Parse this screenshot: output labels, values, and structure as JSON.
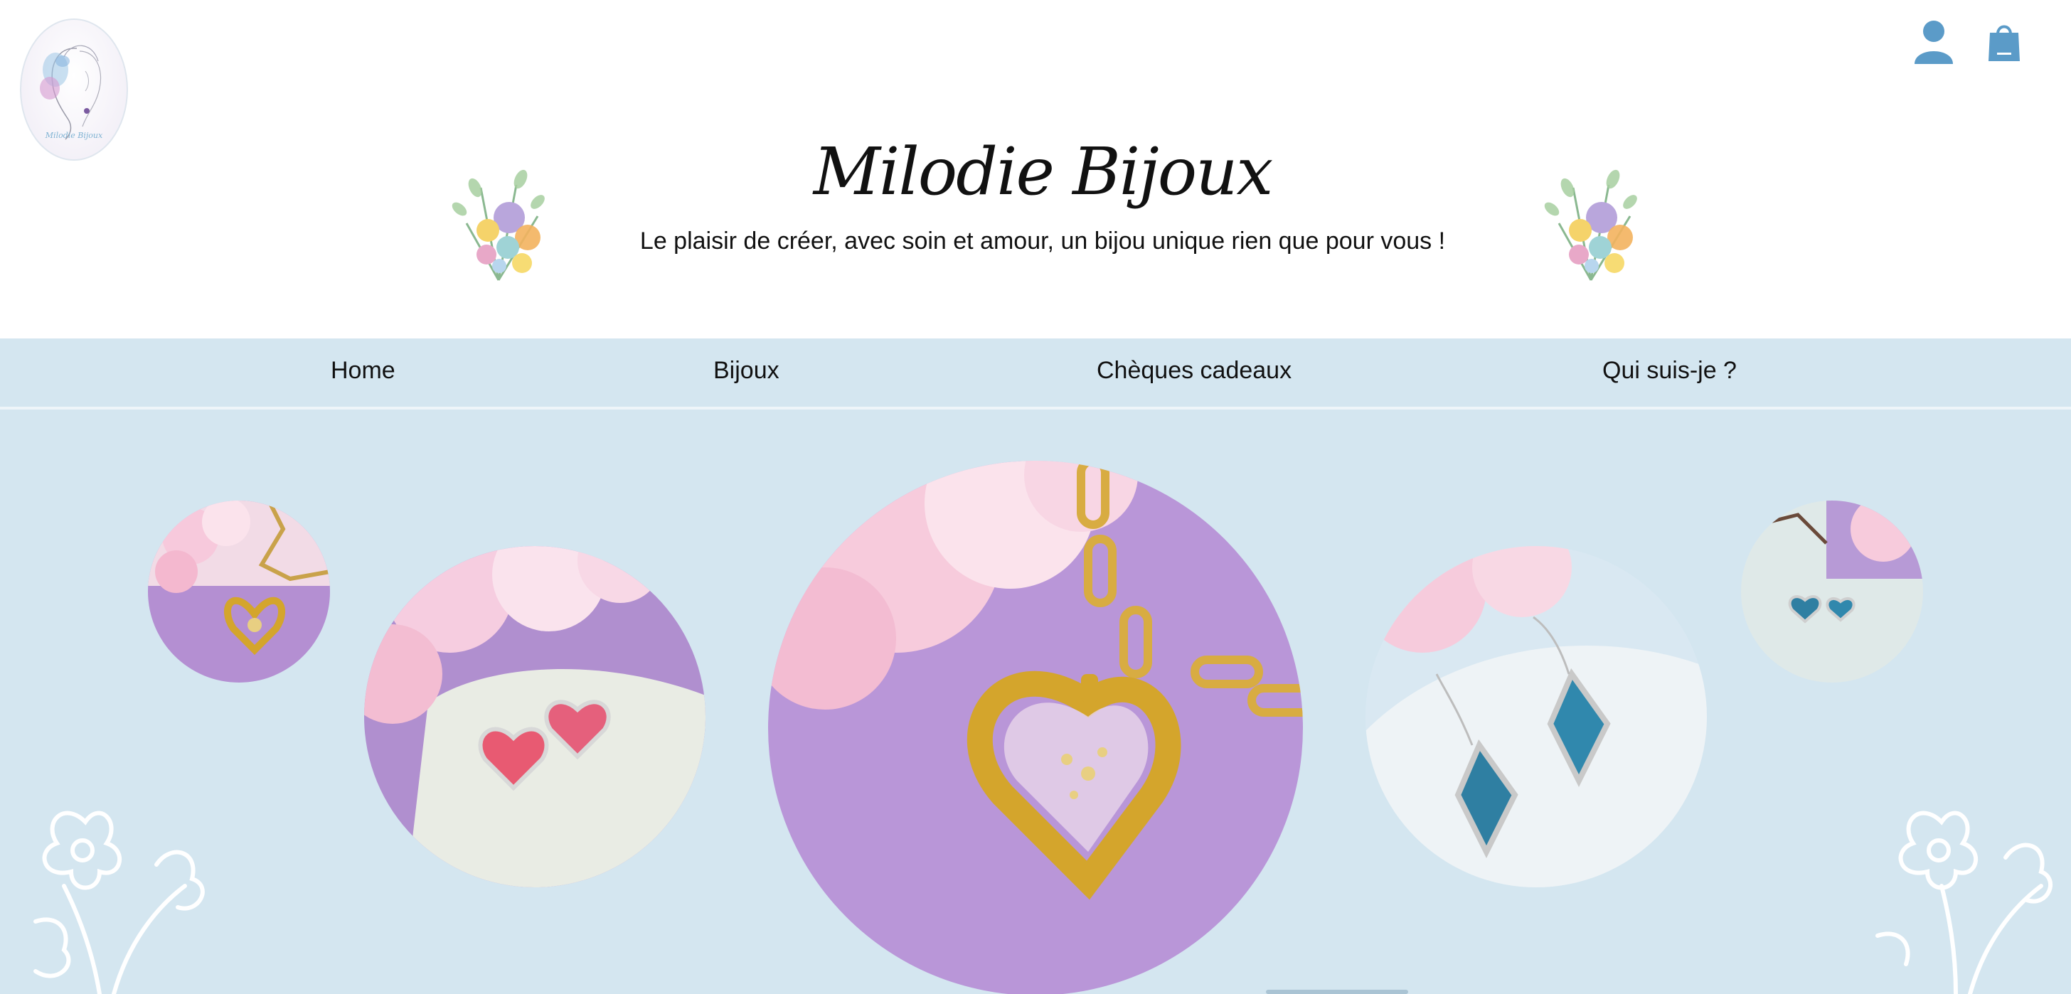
{
  "brand": {
    "title": "Milodie Bijoux",
    "tagline": "Le plaisir de créer, avec soin et amour, un bijou unique rien que pour vous !",
    "logo_text": "Milodie Bijoux"
  },
  "header_icons": {
    "account": "user-icon",
    "cart": "shopping-bag-icon"
  },
  "nav": {
    "items": [
      {
        "label": "Home"
      },
      {
        "label": "Bijoux"
      },
      {
        "label": "Chèques cadeaux"
      },
      {
        "label": "Qui suis-je ?"
      }
    ]
  },
  "gallery": {
    "items": [
      {
        "name": "gold-heart-necklace-small"
      },
      {
        "name": "pink-heart-earrings"
      },
      {
        "name": "gold-heart-necklace-large"
      },
      {
        "name": "blue-diamond-earrings"
      },
      {
        "name": "blue-heart-studs-small"
      }
    ]
  },
  "colors": {
    "nav_bg": "#d4e6f0",
    "icon_blue": "#5b9bc8",
    "lilac": "#b89ad8",
    "gold": "#d4a52c"
  }
}
